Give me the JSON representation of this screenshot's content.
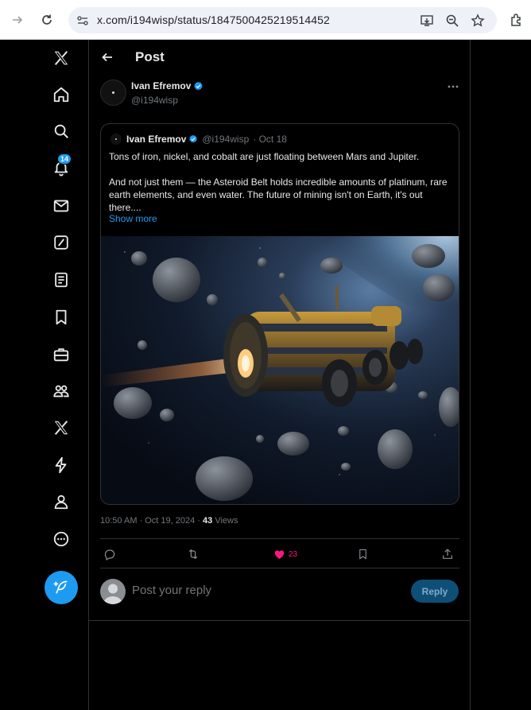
{
  "browser": {
    "url": "x.com/i194wisp/status/1847500425219514452",
    "icons": [
      "forward-icon",
      "reload-icon",
      "site-info-icon",
      "install-app-icon",
      "zoom-icon",
      "bookmark-star-icon",
      "extensions-icon"
    ]
  },
  "nav": {
    "items": [
      "x-logo-icon",
      "home-icon",
      "explore-icon",
      "notifications-icon",
      "messages-icon",
      "grok-icon",
      "lists-icon",
      "bookmarks-icon",
      "jobs-icon",
      "communities-icon",
      "premium-icon",
      "verified-orgs-icon",
      "profile-icon",
      "more-icon"
    ],
    "notif_count": "14",
    "compose_icon": "compose-feather-icon"
  },
  "header": {
    "title": "Post"
  },
  "post": {
    "author_name": "Ivan Efremov",
    "author_handle": "@i194wisp",
    "timestamp": "10:50 AM · Oct 19, 2024 · ",
    "views_count": "43",
    "views_label": " Views"
  },
  "quote": {
    "author_name": "Ivan Efremov",
    "author_handle": "@i194wisp",
    "date": "· Oct 18",
    "text_p1": "Tons of iron, nickel, and cobalt are just floating between Mars and Jupiter.",
    "text_p2": "And not just them — the Asteroid Belt holds incredible amounts of platinum, rare earth elements, and even water. The future of mining isn't on Earth, it's out there....",
    "show_more": "Show more"
  },
  "actions": {
    "like_count": "23",
    "accent_like": "#f91880"
  },
  "reply": {
    "placeholder": "Post your reply",
    "button": "Reply"
  },
  "colors": {
    "accent": "#1d9bf0",
    "background": "#000000",
    "border": "#2f3336",
    "muted": "#71767b"
  }
}
